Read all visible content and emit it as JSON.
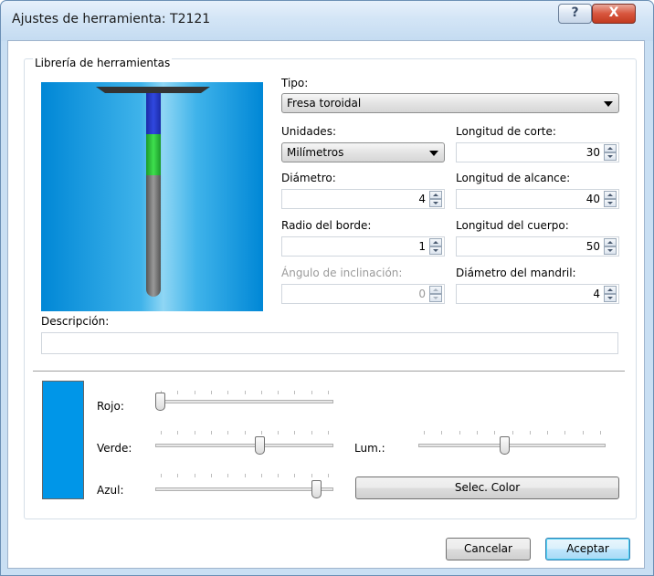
{
  "window": {
    "title": "Ajustes de herramienta: T2121",
    "help_label": "?",
    "close_label": "X"
  },
  "group": {
    "label": "Librería de herramientas"
  },
  "tipo": {
    "label": "Tipo:",
    "value": "Fresa toroidal"
  },
  "unidades": {
    "label": "Unidades:",
    "value": "Milímetros"
  },
  "longitud_corte": {
    "label": "Longitud de corte:",
    "value": "30"
  },
  "diametro": {
    "label": "Diámetro:",
    "value": "4"
  },
  "longitud_alcance": {
    "label": "Longitud de alcance:",
    "value": "40"
  },
  "radio_borde": {
    "label": "Radio del borde:",
    "value": "1"
  },
  "longitud_cuerpo": {
    "label": "Longitud del cuerpo:",
    "value": "50"
  },
  "angulo": {
    "label": "Ángulo de inclinación:",
    "value": "0"
  },
  "diametro_mandril": {
    "label": "Diámetro del mandril:",
    "value": "4"
  },
  "descripcion": {
    "label": "Descripción:",
    "value": ""
  },
  "color": {
    "swatch": "#0096e8",
    "rojo_label": "Rojo:",
    "rojo_level": 0.0,
    "verde_label": "Verde:",
    "verde_level": 0.59,
    "azul_label": "Azul:",
    "azul_level": 0.93,
    "lum_label": "Lum.:",
    "lum_level": 0.46,
    "select_label": "Selec. Color"
  },
  "buttons": {
    "cancel": "Cancelar",
    "ok": "Aceptar"
  }
}
